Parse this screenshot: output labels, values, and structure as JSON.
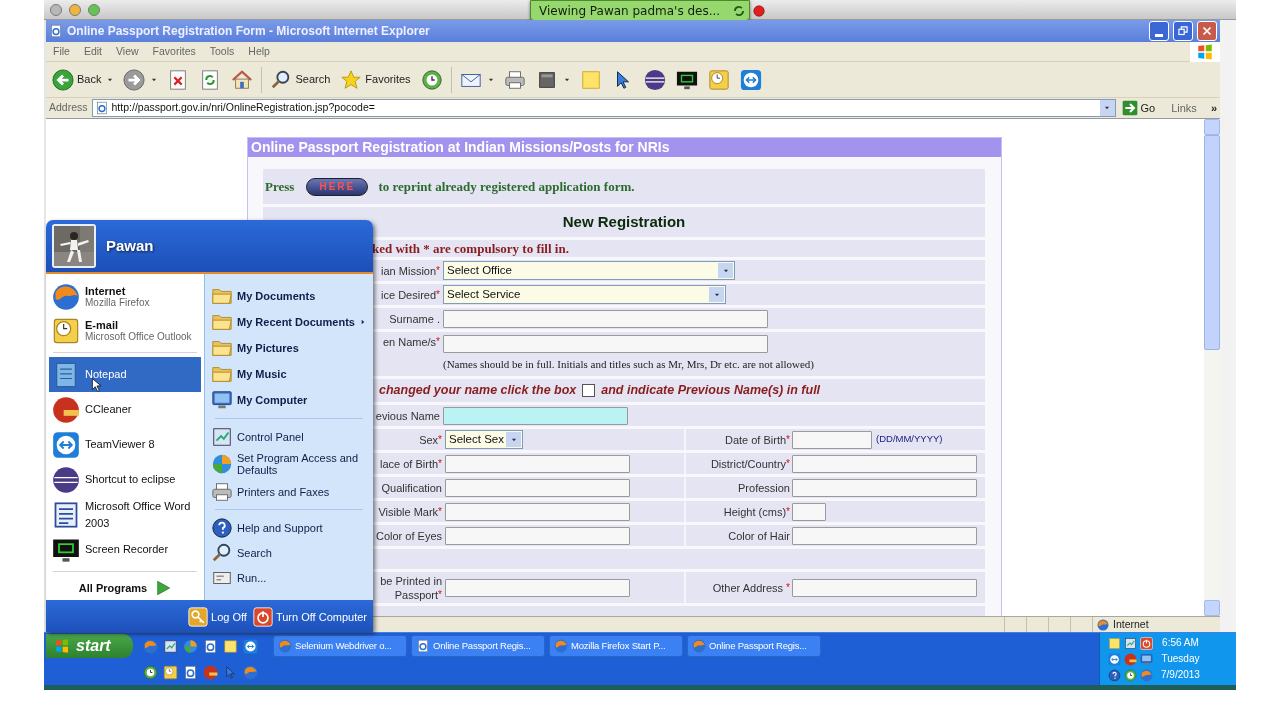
{
  "mac_window": {
    "notification": "Viewing Pawan padma's des..."
  },
  "browser": {
    "title": "Online Passport Registration Form - Microsoft Internet Explorer",
    "menu": [
      "File",
      "Edit",
      "View",
      "Favorites",
      "Tools",
      "Help"
    ],
    "toolbar": {
      "back": "Back",
      "search": "Search",
      "favorites": "Favorites"
    },
    "address": {
      "label": "Address",
      "url": "http://passport.gov.in/nri/OnlineRegistration.jsp?pocode=",
      "go": "Go",
      "links": "Links",
      "more": "»"
    },
    "status_bar": {
      "zone": "Internet"
    }
  },
  "form": {
    "title": "Online Passport Registration at Indian Missions/Posts for NRIs",
    "reprint": {
      "before": "Press",
      "button": "HERE",
      "after": "to reprint already registered application form."
    },
    "heading": "New Registration",
    "compulsory_note": "ked with * are compulsory to fill in.",
    "rows": [
      {
        "kind": "select",
        "label": "ian Mission",
        "mark": "*",
        "value": "Select Office"
      },
      {
        "kind": "select",
        "label": "ice Desired",
        "mark": "*",
        "value": "Select Service"
      },
      {
        "kind": "text",
        "label": "Surname .",
        "highlighted": false
      },
      {
        "kind": "text",
        "label": "en Name/s",
        "mark": "*",
        "highlighted": false,
        "note": "(Names should be in full. Initials and titles such as Mr, Mrs, Dr etc. are not allowed)"
      },
      {
        "kind": "checkbox_line",
        "before": "changed your name click the box",
        "checked": false,
        "after": "and indicate Previous Name(s) in full"
      },
      {
        "kind": "text",
        "label": "evious Name",
        "highlighted": true
      },
      {
        "kind": "pair",
        "left": {
          "kind": "select",
          "label": "Sex",
          "mark": "*",
          "value": "Select Sex"
        },
        "right": {
          "kind": "text",
          "label": "Date of Birth",
          "mark": "*",
          "highlighted": false,
          "hint": "(DD/MM/YYYY)"
        }
      },
      {
        "kind": "pair",
        "left": {
          "kind": "text",
          "label": "lace of Birth",
          "mark": "*",
          "highlighted": false
        },
        "right": {
          "kind": "text",
          "label": "District/Country",
          "mark": "*",
          "highlighted": false
        }
      },
      {
        "kind": "pair",
        "left": {
          "kind": "text",
          "label": "Qualification",
          "highlighted": false
        },
        "right": {
          "kind": "text",
          "label": "Profession",
          "highlighted": false
        }
      },
      {
        "kind": "pair",
        "left": {
          "kind": "text",
          "label": "Visible Mark",
          "mark": "*",
          "highlighted": false
        },
        "right": {
          "kind": "text",
          "label": "Height (cms)",
          "mark": "*",
          "highlighted": false
        }
      },
      {
        "kind": "pair",
        "left": {
          "kind": "text",
          "label": "Color of Eyes",
          "highlighted": false
        },
        "right": {
          "kind": "text",
          "label": "Color of Hair",
          "highlighted": false
        }
      },
      {
        "kind": "blank"
      },
      {
        "kind": "pair",
        "left": {
          "kind": "text",
          "label": "be Printed in\nPassport",
          "mark": "*",
          "highlighted": false
        },
        "right": {
          "kind": "text",
          "label": "Other Address ",
          "mark": "*",
          "highlighted": false
        }
      }
    ]
  },
  "start_menu": {
    "user": "Pawan",
    "pinned": [
      {
        "title": "Internet",
        "subtitle": "Mozilla Firefox",
        "selected": false
      },
      {
        "title": "E-mail",
        "subtitle": "Microsoft Office Outlook",
        "selected": false
      }
    ],
    "recent": [
      {
        "title": "Notepad",
        "selected": true
      },
      {
        "title": "CCleaner",
        "selected": false
      },
      {
        "title": "TeamViewer 8",
        "selected": false
      },
      {
        "title": "Shortcut to eclipse",
        "selected": false
      },
      {
        "title": "Microsoft Office Word 2003",
        "selected": false
      },
      {
        "title": "Screen Recorder",
        "selected": false
      }
    ],
    "all_programs": "All Programs",
    "places": [
      {
        "kind": "primary",
        "items": [
          {
            "label": "My Documents",
            "submenu": false,
            "selected": false
          },
          {
            "label": "My Recent Documents",
            "submenu": true,
            "selected": false
          },
          {
            "label": "My Pictures",
            "submenu": false,
            "selected": false
          },
          {
            "label": "My Music",
            "submenu": false,
            "selected": false
          },
          {
            "label": "My Computer",
            "submenu": false,
            "selected": false
          }
        ]
      },
      {
        "kind": "secondary",
        "items": [
          {
            "label": "Control Panel",
            "submenu": false,
            "selected": false
          },
          {
            "label": "Set Program Access and Defaults",
            "submenu": false,
            "selected": false
          },
          {
            "label": "Printers and Faxes",
            "submenu": false,
            "selected": false
          }
        ]
      },
      {
        "kind": "secondary",
        "items": [
          {
            "label": "Help and Support",
            "submenu": false,
            "selected": false
          },
          {
            "label": "Search",
            "submenu": false,
            "selected": false
          },
          {
            "label": "Run...",
            "submenu": false,
            "selected": false
          }
        ]
      }
    ],
    "log_off": "Log Off",
    "turn_off": "Turn Off Computer"
  },
  "taskbar": {
    "start": "start",
    "tasks": [
      {
        "label": "Selenium Webdriver o..."
      },
      {
        "label": "Online Passport Regis..."
      },
      {
        "label": "Mozilla Firefox Start P..."
      },
      {
        "label": "Online Passport Regis..."
      }
    ],
    "clock": {
      "time": "6:56 AM",
      "day": "Tuesday",
      "date": "7/9/2013"
    }
  }
}
